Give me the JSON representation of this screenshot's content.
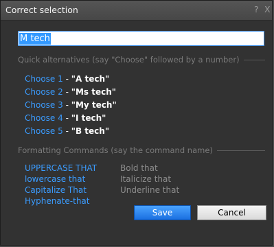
{
  "window": {
    "title": "Correct selection",
    "help_glyph": "?",
    "close_glyph": "X",
    "accent_color": "#3b9cff"
  },
  "input": {
    "value": "M tech"
  },
  "quick_alternatives": {
    "header": "Quick alternatives (say \"Choose\" followed by a number)",
    "items": [
      {
        "label": "Choose 1",
        "sep": " - ",
        "value": "\"A tech\""
      },
      {
        "label": "Choose 2",
        "sep": " - ",
        "value": "\"Ms tech\""
      },
      {
        "label": "Choose 3",
        "sep": " - ",
        "value": "\"My tech\""
      },
      {
        "label": "Choose 4",
        "sep": " - ",
        "value": "\"I tech\""
      },
      {
        "label": "Choose 5",
        "sep": " - ",
        "value": "\"B tech\""
      }
    ]
  },
  "formatting": {
    "header": "Formatting Commands (say the command name)",
    "active_commands": [
      "UPPERCASE THAT",
      "lowercase that",
      "Capitalize That",
      "Hyphenate-that"
    ],
    "inactive_commands": [
      "Bold that",
      "Italicize that",
      "Underline that"
    ]
  },
  "buttons": {
    "save": "Save",
    "cancel": "Cancel"
  }
}
